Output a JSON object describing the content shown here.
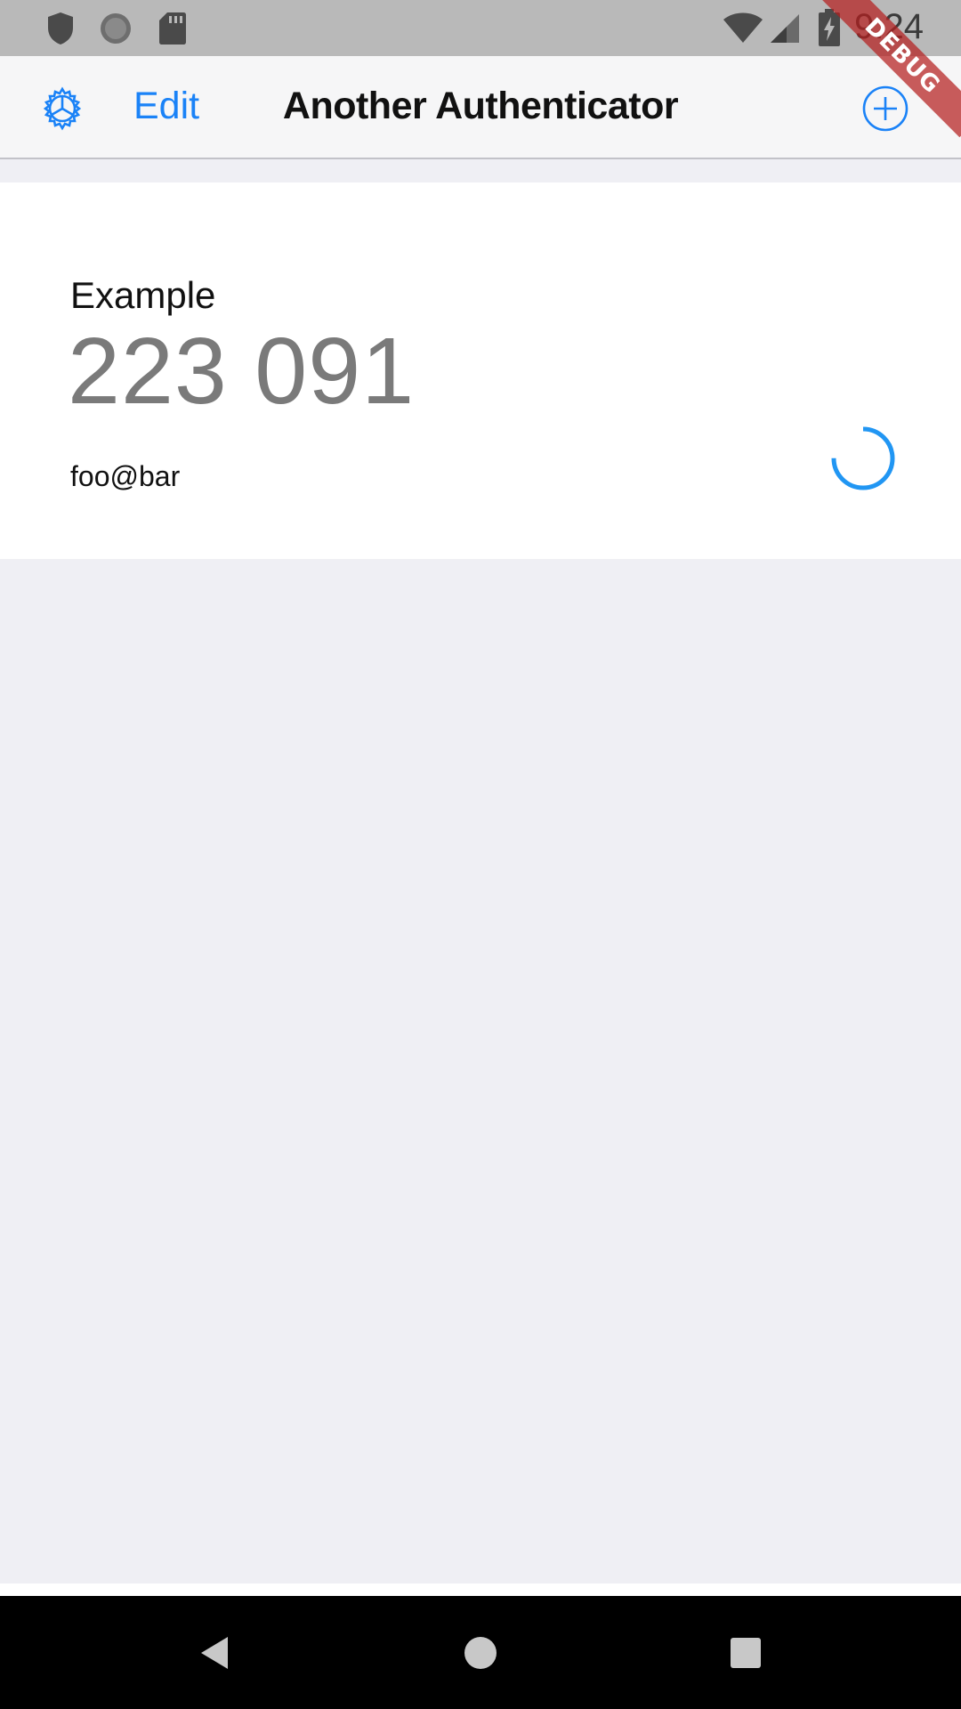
{
  "status_bar": {
    "time": "9:24",
    "icons": [
      "shield-icon",
      "sync-icon",
      "sd-card-icon",
      "wifi-icon",
      "cell-signal-icon",
      "battery-charging-icon"
    ]
  },
  "debug_banner": {
    "label": "DEBUG",
    "color": "#b41e1e"
  },
  "nav_bar": {
    "settings_icon": "gear-icon",
    "edit_label": "Edit",
    "title": "Another Authenticator",
    "add_icon": "plus-circle-icon",
    "accent_color": "#1a82f7"
  },
  "entries": [
    {
      "issuer": "Example",
      "code": "223 091",
      "account": "foo@bar",
      "timer_icon": "countdown-progress-icon",
      "timer_progress": 0.75
    }
  ],
  "android_nav": {
    "back_icon": "back-triangle-icon",
    "home_icon": "home-circle-icon",
    "recents_icon": "recents-square-icon"
  }
}
